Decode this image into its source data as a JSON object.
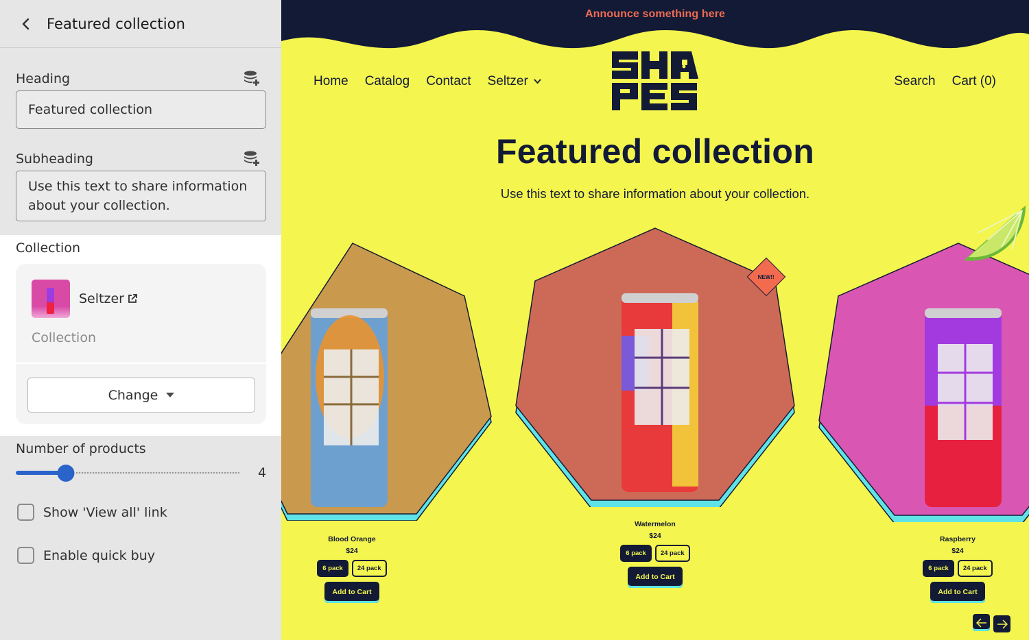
{
  "sidebar": {
    "title": "Featured collection",
    "heading": {
      "label": "Heading",
      "value": "Featured collection"
    },
    "subheading": {
      "label": "Subheading",
      "value": "Use this text to share information about your collection."
    },
    "collection": {
      "label": "Collection",
      "name": "Seltzer",
      "type": "Collection",
      "change_label": "Change"
    },
    "products": {
      "label": "Number of products",
      "value": "4",
      "min": 2,
      "max": 25
    },
    "show_view_all": {
      "label": "Show 'View all' link",
      "checked": false
    },
    "quick_buy": {
      "label": "Enable quick buy",
      "checked": false
    }
  },
  "preview": {
    "announcement": "Announce something here",
    "nav_left": [
      "Home",
      "Catalog",
      "Contact",
      "Seltzer"
    ],
    "nav_right": [
      "Search",
      "Cart (0)"
    ],
    "logo_text": "SHAPES",
    "title": "Featured collection",
    "subtitle": "Use this text to share information about your collection.",
    "badge": "NEW!!",
    "products": [
      {
        "name": "Blood Orange",
        "price": "$24",
        "pack_a": "6 pack",
        "pack_b": "24 pack",
        "cta": "Add to Cart",
        "bg": "#c99a4e"
      },
      {
        "name": "Watermelon",
        "price": "$24",
        "pack_a": "6 pack",
        "pack_b": "24 pack",
        "cta": "Add to Cart",
        "bg": "#cd6a57"
      },
      {
        "name": "Raspberry",
        "price": "$24",
        "pack_a": "6 pack",
        "pack_b": "24 pack",
        "cta": "Add to Cart",
        "bg": "#d957b2"
      }
    ]
  },
  "colors": {
    "accent": "#2a63c9",
    "store_bg": "#f4f54e",
    "store_dark": "#121a36",
    "announce": "#f06b52",
    "teal": "#5fe3e6"
  }
}
